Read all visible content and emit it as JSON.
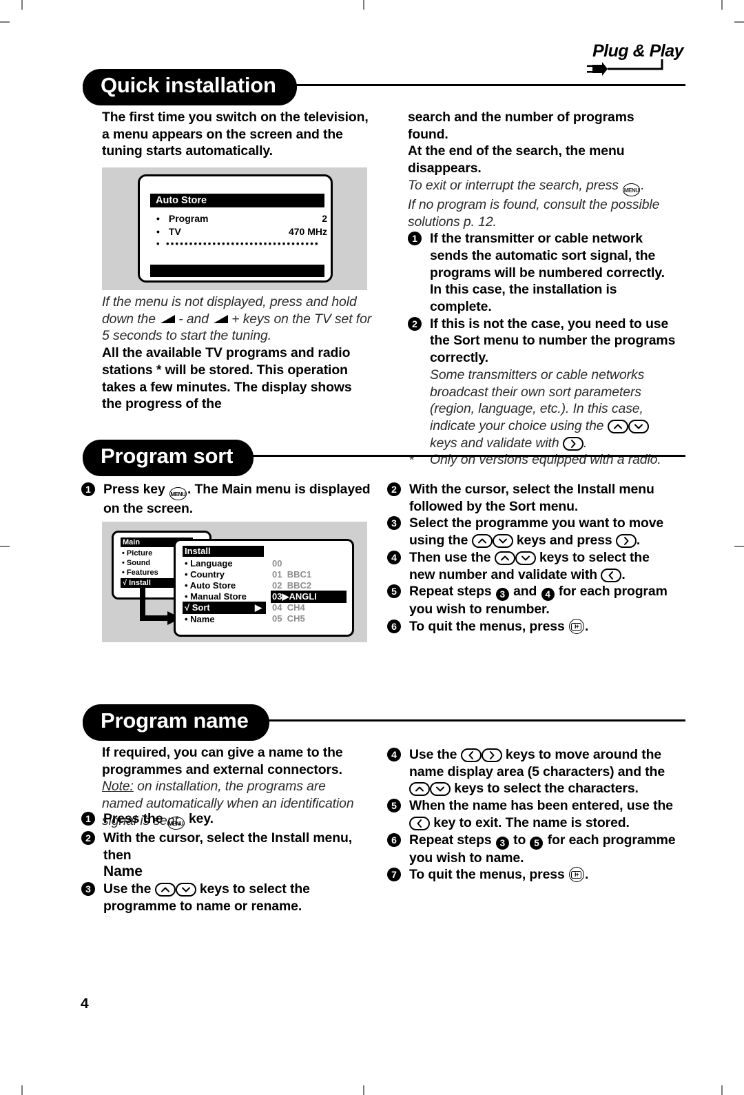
{
  "page": {
    "number": "4",
    "logo": {
      "text": "Plug & Play",
      "icon": "power-plug-icon"
    }
  },
  "sections": [
    {
      "id": "quick-installation",
      "title": "Quick installation",
      "left": {
        "intro": "The first time you switch on the television, a menu appears on the screen and the tuning starts automatically.",
        "figure": {
          "name": "auto-store-osd",
          "osd_title": "Auto Store",
          "rows": [
            {
              "label": "Program",
              "value": "2"
            },
            {
              "label": "TV",
              "value": "470 MHz"
            }
          ],
          "progress_dots": "•••••••••••••••••••••••••••••••••"
        },
        "note_1": "If the menu is not displayed, press and hold down the",
        "note_1b": "- and",
        "note_1c": "+ keys on the TV set for 5 seconds to start the tuning.",
        "body_1": "All the available TV programs and radio stations * will be stored. This operation takes a few minutes. The display shows the progress of the"
      },
      "right": {
        "cont_1": "search and the number of programs found.",
        "cont_2": "At the end of the search, the menu disappears.",
        "note_a": "To exit or interrupt the search, press",
        "note_a_end": ".",
        "note_b": "If no program is found, consult the possible solutions p. 12.",
        "steps": [
          {
            "num": "1",
            "text": "If the transmitter or cable network sends the automatic sort signal, the programs will be numbered correctly. In this case, the installation is complete."
          },
          {
            "num": "2",
            "text_pre": "If this is not the case, you need to use the ",
            "bold_word": "Sort",
            "text_post": " menu to number the programs correctly."
          }
        ],
        "note_c1": "Some transmitters or cable networks broadcast their own sort parameters (region, language, etc.).",
        "note_c2": "In this case, indicate your choice using the",
        "note_c3": "keys and validate with",
        "note_c4": ".",
        "footnote_mark": "*",
        "footnote": "Only on versions equipped with a radio."
      }
    },
    {
      "id": "program-sort",
      "title": "Program sort",
      "left": {
        "step1_pre": "Press key",
        "step1_mid": ". The ",
        "step1_bold": "Main menu",
        "step1_post": " is displayed on the screen.",
        "step1_num": "1",
        "figure": {
          "name": "sort-menu-cascade",
          "main_menu": {
            "header": "Main",
            "items": [
              "Picture",
              "Sound",
              "Features"
            ],
            "selected": "Install"
          },
          "install_menu": {
            "header": "Install",
            "items": [
              "Language",
              "Country",
              "Auto Store",
              "Manual Store"
            ],
            "selected": "Sort",
            "last_item": "Name"
          },
          "channels": [
            {
              "num": "00",
              "name": ""
            },
            {
              "num": "01",
              "name": "BBC1"
            },
            {
              "num": "02",
              "name": "BBC2"
            },
            {
              "num": "03",
              "name": "ANGLI",
              "selected": true
            },
            {
              "num": "04",
              "name": "CH4"
            },
            {
              "num": "05",
              "name": "CH5"
            }
          ]
        }
      },
      "right": {
        "steps": [
          {
            "num": "2",
            "pre": "With the cursor, select the ",
            "bold": "Install",
            "mid": " menu followed by the ",
            "bold2": "Sort",
            "post": " menu."
          },
          {
            "num": "3",
            "pre": "Select the programme you want to move using the ",
            "post": " keys and press ",
            "end": "."
          },
          {
            "num": "4",
            "pre": "Then use the ",
            "post": " keys to select the new number and validate with ",
            "end": "."
          },
          {
            "num": "5",
            "pre": "Repeat steps ",
            "a": "3",
            "mid": " and ",
            "b": "4",
            "post": " for each program you wish to renumber."
          },
          {
            "num": "6",
            "pre": "To quit the menus, press ",
            "end": "."
          }
        ]
      }
    },
    {
      "id": "program-name",
      "title": "Program name",
      "left": {
        "intro": "If required, you can give a name to the programmes and external connectors.",
        "note_label": "Note:",
        "note_text": " on installation, the programs are named automatically when an identification signal is sent.",
        "steps": [
          {
            "num": "1",
            "pre": "Press the ",
            "post": " key."
          },
          {
            "num": "2",
            "pre": "With the cursor, select the ",
            "bold": "Install",
            "mid": " menu, then",
            "bold2": "Name"
          },
          {
            "num": "3",
            "pre": "Use the ",
            "post": " keys to select the programme to name or rename."
          }
        ]
      },
      "right": {
        "steps": [
          {
            "num": "4",
            "pre": "Use the ",
            "mid": " keys to move around the name display area (5 characters) and the ",
            "post": " keys to select the characters."
          },
          {
            "num": "5",
            "pre": "When the name has been entered, use the ",
            "post": " key to exit. The name is stored."
          },
          {
            "num": "6",
            "pre": "Repeat steps ",
            "a": "3",
            "mid": " to ",
            "b": "5",
            "post": " for each programme you wish to name."
          },
          {
            "num": "7",
            "pre": "To quit the menus, press ",
            "end": "."
          }
        ]
      }
    }
  ],
  "icons": {
    "menu_key": "MENU",
    "info_key": "i+",
    "up_key": "chevron-up",
    "down_key": "chevron-down",
    "left_key": "chevron-left",
    "right_key": "chevron-right",
    "volume_key": "volume-wedge"
  },
  "colors": {
    "ink": "#000000",
    "paper": "#ffffff",
    "figure_bg": "#cfcfcf",
    "muted_text": "#8e8e8e",
    "cropmark": "#7a7a7a"
  }
}
